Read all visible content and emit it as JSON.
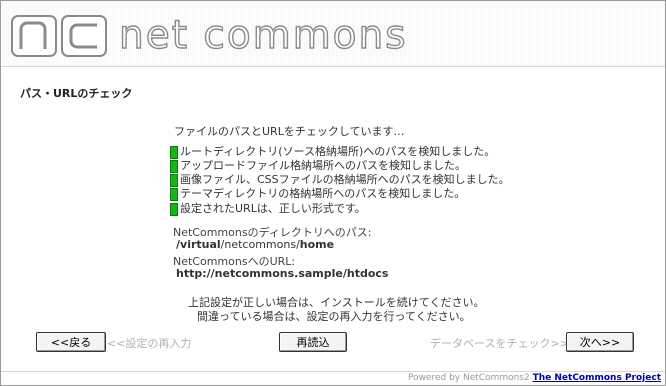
{
  "header": {
    "brand_text": "net commons",
    "logo_icon": "nc-logo-icon"
  },
  "page": {
    "title": "パス・URLのチェック"
  },
  "intro": "ファイルのパスとURLをチェックしています…",
  "checks": [
    "ルートディレクトリ(ソース格納場所)へのパスを検知しました。",
    "アップロードファイル格納場所へのパスを検知しました。",
    "画像ファイル、CSSファイルの格納場所へのパスを検知しました。",
    "テーマディレクトリの格納場所へのパスを検知しました。",
    "設定されたURLは、正しい形式です。"
  ],
  "path": {
    "label": "NetCommonsのディレクトリへのパス:",
    "value_part1": "/virtual",
    "value_part2": "/netcommons/",
    "value_part3": "home"
  },
  "url": {
    "label": "NetCommonsへのURL:",
    "value": "http://netcommons.sample/htdocs"
  },
  "notes": {
    "line1": "上記設定が正しい場合は、インストールを続けてください。",
    "line2": "間違っている場合は、設定の再入力を行ってください。"
  },
  "buttons": {
    "back": "<<戻る",
    "reload": "再読込",
    "next": "次へ>>"
  },
  "hints": {
    "back": "<<設定の再入力",
    "next": "データベースをチェック>>"
  },
  "footer": {
    "powered": "Powered by NetCommons2",
    "project": "The NetCommons Project"
  },
  "colors": {
    "check": "#17b617",
    "link": "#0000aa"
  }
}
